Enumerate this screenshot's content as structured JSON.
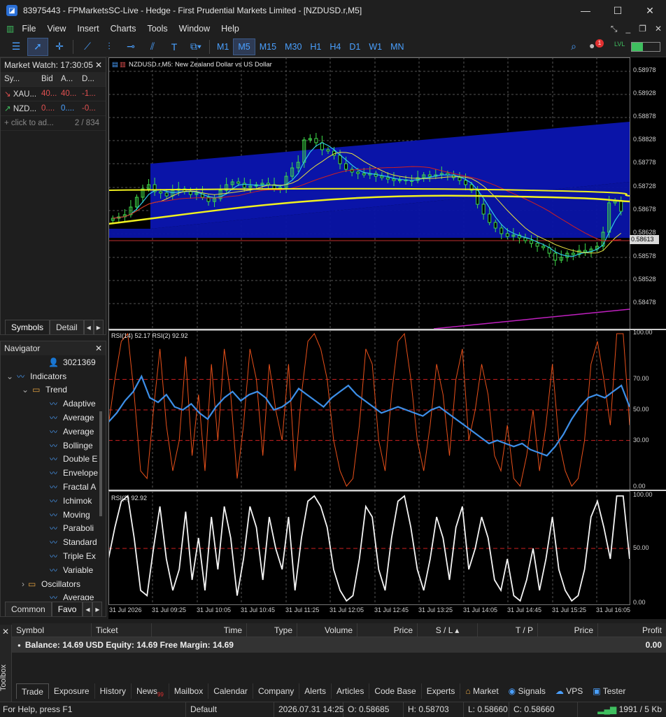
{
  "window": {
    "title": "83975443 - FPMarketsSC-Live - Hedge - First Prudential Markets Limited - [NZDUSD.r,M5]"
  },
  "menu": [
    "File",
    "View",
    "Insert",
    "Charts",
    "Tools",
    "Window",
    "Help"
  ],
  "timeframes": [
    "M1",
    "M5",
    "M15",
    "M30",
    "H1",
    "H4",
    "D1",
    "W1",
    "MN"
  ],
  "active_timeframe": "M5",
  "notification_count": "1",
  "market_watch": {
    "title": "Market Watch: 17:30:05",
    "columns": [
      "Sy...",
      "Bid",
      "A...",
      "D..."
    ],
    "rows": [
      {
        "symbol": "XAU...",
        "bid": "40...",
        "ask": "40...",
        "daily": "-1...",
        "dir": "down"
      },
      {
        "symbol": "NZD...",
        "bid": "0....",
        "ask": "0....",
        "daily": "-0...",
        "dir": "up"
      }
    ],
    "add_text": "click to ad...",
    "count": "2 / 834",
    "tabs": [
      "Symbols",
      "Detail"
    ]
  },
  "navigator": {
    "title": "Navigator",
    "account": "3021369",
    "indicators_label": "Indicators",
    "trend_label": "Trend",
    "trend_items": [
      "Adaptive",
      "Average",
      "Average",
      "Bollinge",
      "Double E",
      "Envelope",
      "Fractal A",
      "Ichimok",
      "Moving",
      "Paraboli",
      "Standard",
      "Triple Ex",
      "Variable"
    ],
    "oscillators_label": "Oscillators",
    "osc_first": "Average",
    "tabs": [
      "Common",
      "Favo"
    ]
  },
  "chart": {
    "symbol_label": "NZDUSD.r,M5:  New Zealand Dollar vs US Dollar",
    "price_ticks": [
      "0.58978",
      "0.58928",
      "0.58878",
      "0.58828",
      "0.58778",
      "0.58728",
      "0.58678",
      "0.58628",
      "0.58578",
      "0.58528",
      "0.58478"
    ],
    "current_price": "0.58613",
    "rsi_label": "RSI(14) 52.17 RSI(2) 92.92",
    "rsi_ticks": [
      "100.00",
      "70.00",
      "50.00",
      "30.00",
      "0.00"
    ],
    "rsi2_label": "RSI(2) 92.92",
    "rsi2_ticks": [
      "100.00",
      "50.00",
      "0.00"
    ],
    "time_ticks": [
      "31 Jul 2026",
      "31 Jul 09:25",
      "31 Jul 10:05",
      "31 Jul 10:45",
      "31 Jul 11:25",
      "31 Jul 12:05",
      "31 Jul 12:45",
      "31 Jul 13:25",
      "31 Jul 14:05",
      "31 Jul 14:45",
      "31 Jul 15:25",
      "31 Jul 16:05"
    ]
  },
  "toolbox": {
    "side_label": "Toolbox",
    "columns": [
      "Symbol",
      "Ticket",
      "Time",
      "Type",
      "Volume",
      "Price",
      "S / L",
      "T / P",
      "Price",
      "Profit"
    ],
    "balance_text": "Balance: 14.69 USD  Equity: 14.69  Free Margin: 14.69",
    "profit": "0.00",
    "tabs": [
      "Trade",
      "Exposure",
      "History",
      "News",
      "Mailbox",
      "Calendar",
      "Company",
      "Alerts",
      "Articles",
      "Code Base",
      "Experts"
    ],
    "news_badge": "99",
    "right_tabs": [
      "Market",
      "Signals",
      "VPS",
      "Tester"
    ]
  },
  "status": {
    "help": "For Help, press F1",
    "profile": "Default",
    "datetime": "2026.07.31 14:25",
    "open": "O: 0.58685",
    "high": "H: 0.58703",
    "low": "L: 0.58660",
    "close": "C: 0.58660",
    "traffic": "1991 / 5 Kb"
  },
  "colors": {
    "accent": "#4aa0ff",
    "rsi14": "#e8501a",
    "rsi2_line": "#3d8fe8",
    "level": "#cc2020",
    "channel": "#0a14a8"
  }
}
